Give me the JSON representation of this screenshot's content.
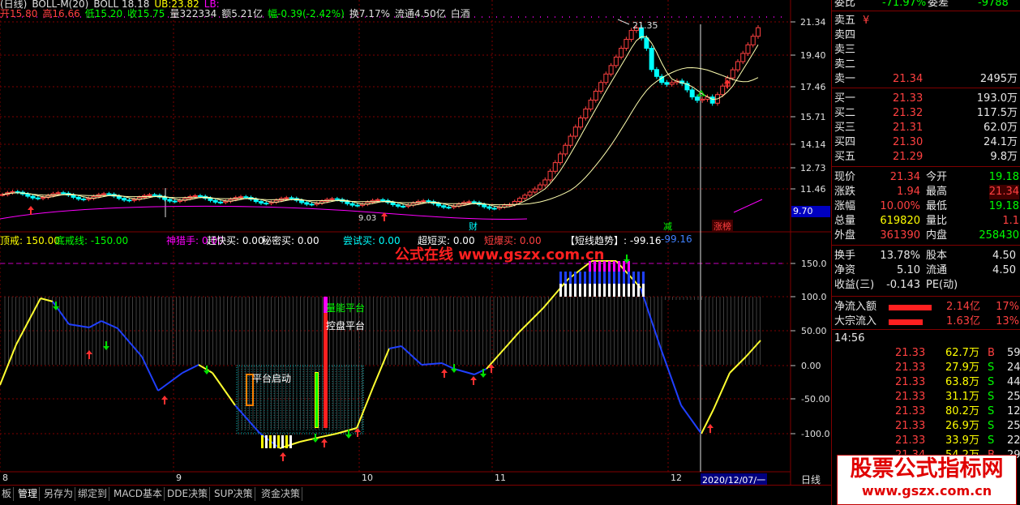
{
  "header": {
    "info_line": [
      {
        "text": "(日线)",
        "color": "#e0e0e0"
      },
      {
        "text": "BOLL-M(20)",
        "color": "#e0e0e0"
      },
      {
        "text": "BOLL 18.18",
        "color": "#e0e0e0"
      },
      {
        "text": "UB:23.82",
        "color": "#ffff00"
      },
      {
        "text": "LB:",
        "color": "#ff00ff"
      }
    ],
    "ohlc_line": [
      {
        "text": "开15.80",
        "color": "#ff4040"
      },
      {
        "text": "高16.66",
        "color": "#ff4040"
      },
      {
        "text": "低15.20",
        "color": "#00ff00"
      },
      {
        "text": "收15.75",
        "color": "#00ff00"
      },
      {
        "text": "量322334",
        "color": "#e0e0e0"
      },
      {
        "text": "额5.21亿",
        "color": "#e0e0e0"
      },
      {
        "text": "幅-0.39(-2.42%)",
        "color": "#00ff00"
      },
      {
        "text": "换7.17%",
        "color": "#e0e0e0"
      },
      {
        "text": "流通4.50亿",
        "color": "#e0e0e0"
      },
      {
        "text": "白酒",
        "color": "#e0e0e0"
      }
    ],
    "peak_label": "21.35",
    "low_label": "9.03"
  },
  "price_axis": [
    "21.34",
    "19.40",
    "17.46",
    "15.71",
    "14.14",
    "12.73",
    "11.46"
  ],
  "price_box": "9.70",
  "event_tags": [
    {
      "text": "财",
      "color": "#00ffff"
    },
    {
      "text": "减",
      "color": "#00ff00"
    },
    {
      "text": "涨榜",
      "color": "#ff4040"
    }
  ],
  "indicator": {
    "labels": [
      {
        "text": "顶戒: 150.00",
        "color": "#ffff00"
      },
      {
        "text": "底戒线: -150.00",
        "color": "#00ff00"
      },
      {
        "text": "神猎手: 0.00",
        "color": "#ff00ff"
      },
      {
        "text": "赶快买: 0.00",
        "color": "#ffffff"
      },
      {
        "text": "秘密买: 0.00",
        "color": "#ffffff"
      },
      {
        "text": "尝试买: 0.00",
        "color": "#00ffff"
      },
      {
        "text": "超短买: 0.00",
        "color": "#ffffff"
      },
      {
        "text": "短爆买: 0.00",
        "color": "#ff4040"
      },
      {
        "text": "【短线趋势】: -99.16",
        "color": "#ffffff"
      },
      {
        "text": "-99.16",
        "color": "#4080ff"
      }
    ],
    "watermark": "公式在线 www.gszx.com.cn",
    "annotations": {
      "volume_platform": "量能平台",
      "control_platform": "控盘平台",
      "platform_start": "平台启动"
    },
    "axis": [
      "150.0",
      "100.0",
      "50.00",
      "0.00",
      "-50.00",
      "-100.0"
    ]
  },
  "months": [
    "8",
    "9",
    "10",
    "11",
    "12"
  ],
  "cursor_date": "2020/12/07/一",
  "period_label": "日线",
  "plus_btn": "+",
  "minus_btn": "-",
  "tabs": [
    "板",
    "管理",
    "另存为",
    "绑定到",
    "MACD基本",
    "DDE决策",
    "SUP决策",
    "资金决策"
  ],
  "right_panel": {
    "wei_bi_label": "委比",
    "wei_bi_value": "-71.97%",
    "wei_cha_label": "委差",
    "wei_cha_value": "-9788",
    "sell": [
      {
        "label": "卖五",
        "price": "¥",
        "vol": ""
      },
      {
        "label": "卖四",
        "price": "",
        "vol": ""
      },
      {
        "label": "卖三",
        "price": "",
        "vol": ""
      },
      {
        "label": "卖二",
        "price": "",
        "vol": ""
      },
      {
        "label": "卖一",
        "price": "21.34",
        "vol": "2495万"
      }
    ],
    "buy": [
      {
        "label": "买一",
        "price": "21.33",
        "vol": "193.0万"
      },
      {
        "label": "买二",
        "price": "21.32",
        "vol": "117.5万"
      },
      {
        "label": "买三",
        "price": "21.31",
        "vol": "62.0万"
      },
      {
        "label": "买四",
        "price": "21.30",
        "vol": "24.1万"
      },
      {
        "label": "买五",
        "price": "21.29",
        "vol": "9.8万"
      }
    ],
    "stats": [
      {
        "l1": "现价",
        "v1": "21.34",
        "c1": "#ff4040",
        "l2": "今开",
        "v2": "19.18",
        "c2": "#00ff00"
      },
      {
        "l1": "涨跌",
        "v1": "1.94",
        "c1": "#ff4040",
        "l2": "最高",
        "v2": "21.34",
        "c2": "#ff4040"
      },
      {
        "l1": "涨幅",
        "v1": "10.00%",
        "c1": "#ff4040",
        "l2": "最低",
        "v2": "19.18",
        "c2": "#00ff00"
      },
      {
        "l1": "总量",
        "v1": "619820",
        "c1": "#ffff00",
        "l2": "量比",
        "v2": "1.1",
        "c2": "#ff4040"
      },
      {
        "l1": "外盘",
        "v1": "361390",
        "c1": "#ff4040",
        "l2": "内盘",
        "v2": "258430",
        "c2": "#00ff00"
      }
    ],
    "stats2": [
      {
        "l1": "换手",
        "v1": "13.78%",
        "c1": "#e8e8e8",
        "l2": "股本",
        "v2": "4.50",
        "c2": "#e8e8e8"
      },
      {
        "l1": "净资",
        "v1": "5.10",
        "c1": "#e8e8e8",
        "l2": "流通",
        "v2": "4.50",
        "c2": "#e8e8e8"
      },
      {
        "l1": "收益(三)",
        "v1": "-0.143",
        "c1": "#e8e8e8",
        "l2": "PE(动)",
        "v2": "",
        "c2": "#e8e8e8"
      }
    ],
    "flows": [
      {
        "label": "净流入额",
        "value": "2.14亿",
        "pct": "17%",
        "bar": 0.88
      },
      {
        "label": "大宗流入",
        "value": "1.63亿",
        "pct": "13%",
        "bar": 0.7
      }
    ],
    "time": "14:56",
    "ticks": [
      {
        "p": "21.33",
        "v": "62.7万",
        "bs": "B",
        "n": "59"
      },
      {
        "p": "21.33",
        "v": "27.9万",
        "bs": "S",
        "n": "24"
      },
      {
        "p": "21.33",
        "v": "63.8万",
        "bs": "S",
        "n": "44"
      },
      {
        "p": "21.33",
        "v": "31.1万",
        "bs": "S",
        "n": "25"
      },
      {
        "p": "21.33",
        "v": "80.2万",
        "bs": "S",
        "n": "12"
      },
      {
        "p": "21.33",
        "v": "26.9万",
        "bs": "S",
        "n": "25"
      },
      {
        "p": "21.33",
        "v": "33.9万",
        "bs": "S",
        "n": "22"
      },
      {
        "p": "21.34",
        "v": "54.2万",
        "bs": "B",
        "n": "29"
      }
    ],
    "logo": "股票公式指标网",
    "logo_url": "www.gszx.com.cn"
  },
  "colors": {
    "up": "#ff4040",
    "down": "#00ffff",
    "grid": "#800000",
    "ma_yellow": "#ffff99",
    "purple": "#ff00ff",
    "blue_line": "#2040ff",
    "yellow_line": "#ffff30"
  }
}
